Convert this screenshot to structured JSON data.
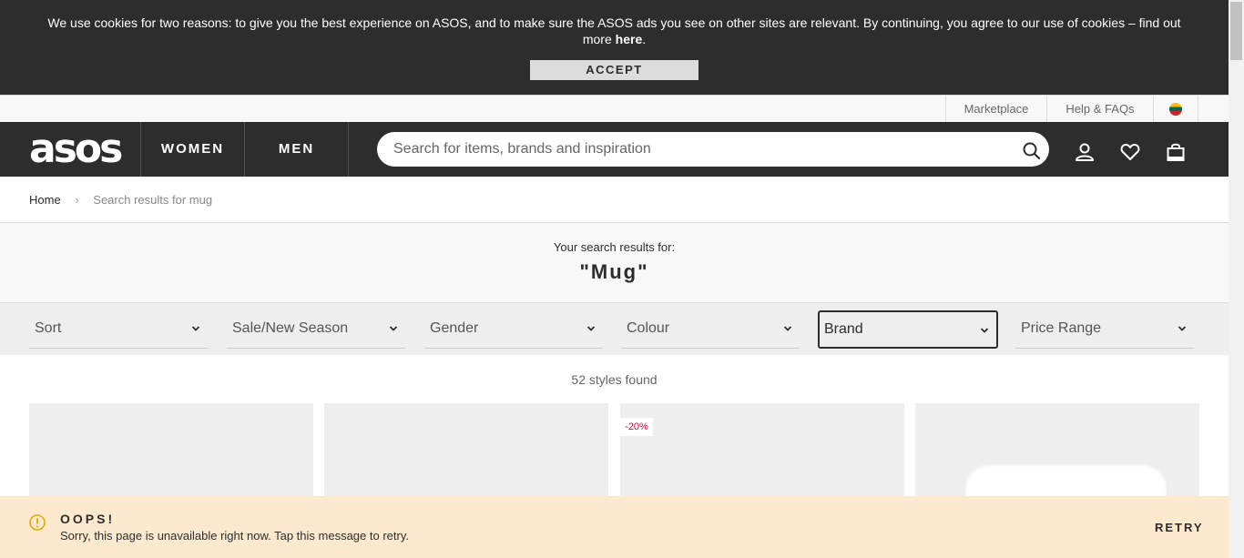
{
  "cookie_banner": {
    "text_before": "We use cookies for two reasons: to give you the best experience on ASOS, and to make sure the ASOS ads you see on other sites are relevant. By continuing, you agree to our use of cookies – find out more",
    "link_text": "here",
    "text_after": ".",
    "accept_label": "ACCEPT"
  },
  "utility_bar": {
    "marketplace": "Marketplace",
    "help": "Help & FAQs",
    "flag_icon": "lithuania-flag-icon"
  },
  "nav": {
    "logo": "asos",
    "women": "WOMEN",
    "men": "MEN",
    "search_placeholder": "Search for items, brands and inspiration",
    "icons": [
      "search-icon",
      "account-icon",
      "heart-icon",
      "bag-icon"
    ]
  },
  "breadcrumb": {
    "home": "Home",
    "separator": "›",
    "current": "Search results for mug"
  },
  "search_header": {
    "label": "Your search results for:",
    "query": "\"Mug\""
  },
  "filters": [
    {
      "label": "Sort"
    },
    {
      "label": "Sale/New Season"
    },
    {
      "label": "Gender"
    },
    {
      "label": "Colour"
    },
    {
      "label": "Brand"
    },
    {
      "label": "Price Range"
    }
  ],
  "results_count": "52 styles found",
  "products": {
    "discount_badge": "-20%",
    "badge_color": "#c3092e"
  },
  "error_banner": {
    "title": "OOPS!",
    "message": "Sorry, this page is unavailable right now. Tap this message to retry.",
    "retry_label": "RETRY",
    "background": "#fde9cd",
    "icon": "warning-icon"
  }
}
